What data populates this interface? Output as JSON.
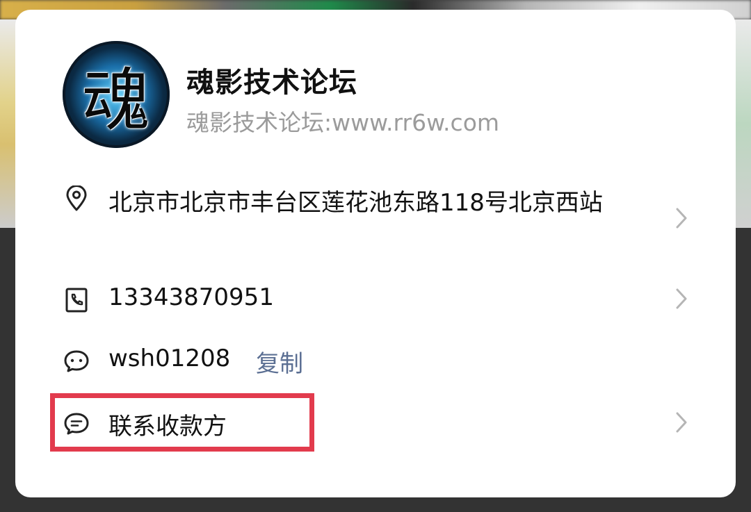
{
  "card": {
    "avatar_char": "魂",
    "title": "魂影技术论坛",
    "subtitle": "魂影技术论坛:www.rr6w.com"
  },
  "rows": {
    "address": {
      "icon": "location-pin-icon",
      "text": "北京市北京市丰台区莲花池东路118号北京西站"
    },
    "phone": {
      "icon": "phone-icon",
      "text": "13343870951"
    },
    "wechat": {
      "icon": "chat-bubble-icon",
      "text": "wsh01208",
      "copy_label": "复制"
    },
    "contact": {
      "icon": "message-icon",
      "text": "联系收款方"
    }
  },
  "colors": {
    "highlight": "#e23b4d",
    "link": "#5b6f93",
    "subtitle": "#9b9b9b"
  }
}
